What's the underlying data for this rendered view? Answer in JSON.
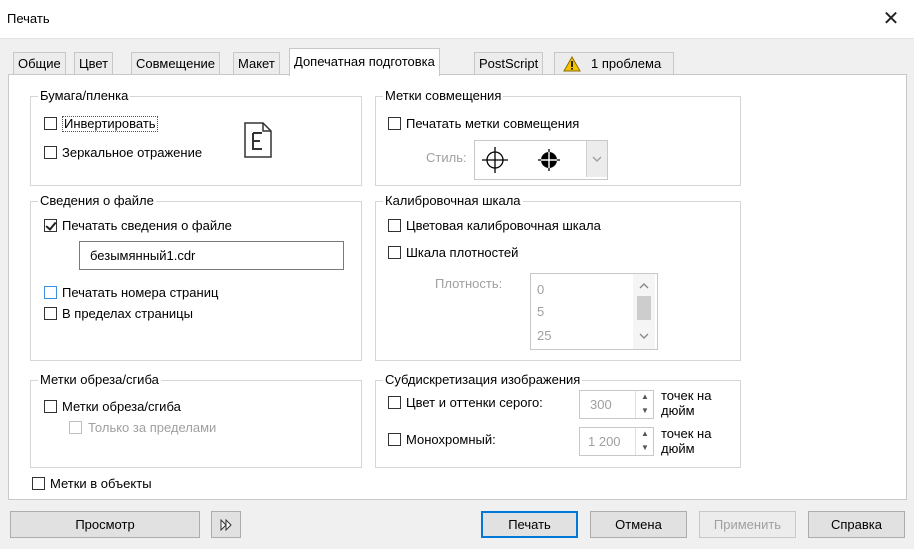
{
  "window": {
    "title": "Печать"
  },
  "tabs": [
    {
      "label": "Общие"
    },
    {
      "label": "Цвет"
    },
    {
      "label": "Совмещение"
    },
    {
      "label": "Макет"
    },
    {
      "label": "Допечатная подготовка"
    },
    {
      "label": "PostScript"
    },
    {
      "label": "1 проблема"
    }
  ],
  "paper": {
    "title": "Бумага/пленка",
    "invert": {
      "label": "Инвертировать",
      "checked": false
    },
    "mirror": {
      "label": "Зеркальное отражение",
      "checked": false
    }
  },
  "registration": {
    "title": "Метки совмещения",
    "print_marks": {
      "label": "Печатать метки совмещения",
      "checked": false
    },
    "style_label": "Стиль:"
  },
  "file_info": {
    "title": "Сведения о файле",
    "print_info": {
      "label": "Печатать сведения о файле",
      "checked": true
    },
    "filename": "безымянный1.cdr",
    "page_numbers": {
      "label": "Печатать номера страниц",
      "checked": false
    },
    "within_page": {
      "label": "В пределах страницы",
      "checked": false
    }
  },
  "calibration": {
    "title": "Калибровочная шкала",
    "color_bar": {
      "label": "Цветовая калибровочная шкала",
      "checked": false
    },
    "densitometer": {
      "label": "Шкала плотностей",
      "checked": false
    },
    "density_label": "Плотность:",
    "density_values": [
      "0",
      "5",
      "25"
    ]
  },
  "crop": {
    "title": "Метки обреза/сгиба",
    "crop_marks": {
      "label": "Метки обреза/сгиба",
      "checked": false
    },
    "exterior_only": {
      "label": "Только за пределами",
      "checked": false
    }
  },
  "downsample": {
    "title": "Субдискретизация изображения",
    "color": {
      "label": "Цвет и оттенки серого:",
      "value": "300",
      "unit_line1": "точек на",
      "unit_line2": "дюйм"
    },
    "mono": {
      "label": "Монохромный:",
      "value": "1 200",
      "unit_line1": "точек на",
      "unit_line2": "дюйм"
    }
  },
  "marks_to_objects": {
    "label": "Метки в объекты",
    "checked": false
  },
  "buttons": {
    "preview": "Просмотр",
    "print": "Печать",
    "cancel": "Отмена",
    "apply": "Применить",
    "help": "Справка"
  },
  "colors": {
    "accent": "#0078d7",
    "warning": "#f5c400"
  }
}
